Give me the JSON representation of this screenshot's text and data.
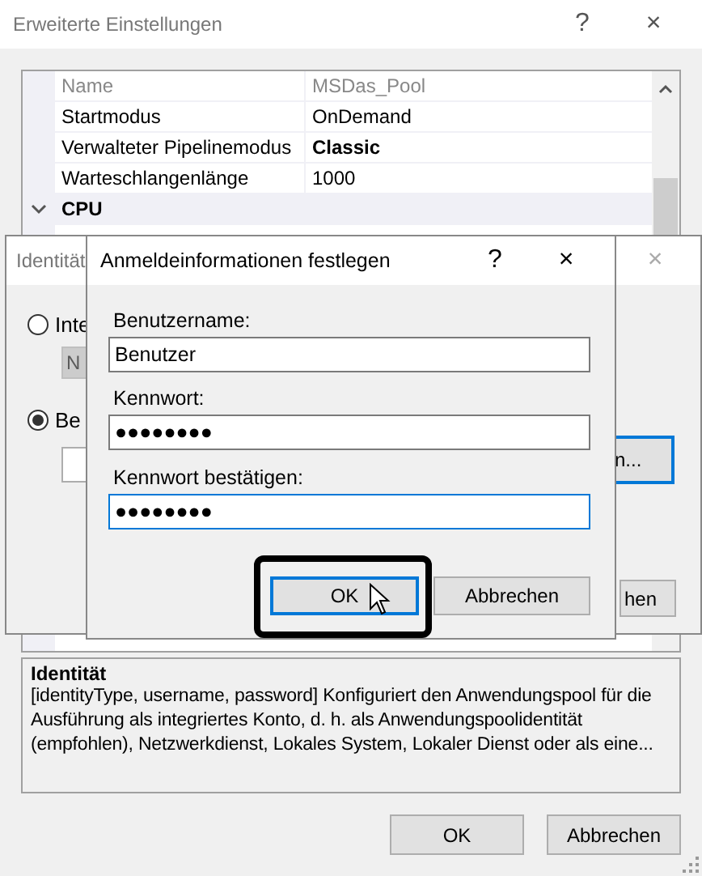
{
  "main_window": {
    "title": "Erweiterte Einstellungen",
    "help": "?",
    "close": "×"
  },
  "properties": [
    {
      "kind": "property",
      "name": "Name",
      "value": "MSDas_Pool",
      "disabled": true,
      "modified": false
    },
    {
      "kind": "property",
      "name": "Startmodus",
      "value": "OnDemand",
      "disabled": false,
      "modified": false
    },
    {
      "kind": "property",
      "name": "Verwalteter Pipelinemodus",
      "value": "Classic",
      "disabled": false,
      "modified": true
    },
    {
      "kind": "property",
      "name": "Warteschlangenlänge",
      "value": "1000",
      "disabled": false,
      "modified": false
    },
    {
      "kind": "category",
      "name": "CPU",
      "expanded": true
    }
  ],
  "description": {
    "title": "Identität",
    "text": "[identityType, username, password] Konfiguriert den Anwendungspool für die Ausführung als integriertes Konto, d. h. als Anwendungspoolidentität (empfohlen), Netzwerkdienst, Lokales System, Lokaler Dienst oder als eine..."
  },
  "buttons": [
    {
      "label": "OK"
    },
    {
      "label": "Abbrechen"
    }
  ],
  "identity_dialog": {
    "title": "Identität",
    "close": "×",
    "options": [
      {
        "label": "Inte",
        "selected": false
      },
      {
        "label": "Be",
        "selected": true
      }
    ],
    "buttons": [
      {
        "label": "N",
        "disabled": true,
        "focused": false
      },
      {
        "label": "n...",
        "disabled": false,
        "focused": true
      },
      {
        "label": "hen",
        "disabled": false,
        "focused": false
      }
    ]
  },
  "credentials_dialog": {
    "title": "Anmeldeinformationen festlegen",
    "help": "?",
    "close": "×",
    "fields": [
      {
        "label": "Benutzername:",
        "value": "Benutzer",
        "focused": false
      },
      {
        "label": "Kennwort:",
        "value": "●●●●●●●●",
        "focused": false
      },
      {
        "label": "Kennwort bestätigen:",
        "value": "●●●●●●●●",
        "focused": true
      }
    ],
    "buttons": [
      {
        "label": "OK",
        "focused": true,
        "highlighted": true
      },
      {
        "label": "Abbrechen",
        "focused": false,
        "highlighted": false
      }
    ]
  }
}
